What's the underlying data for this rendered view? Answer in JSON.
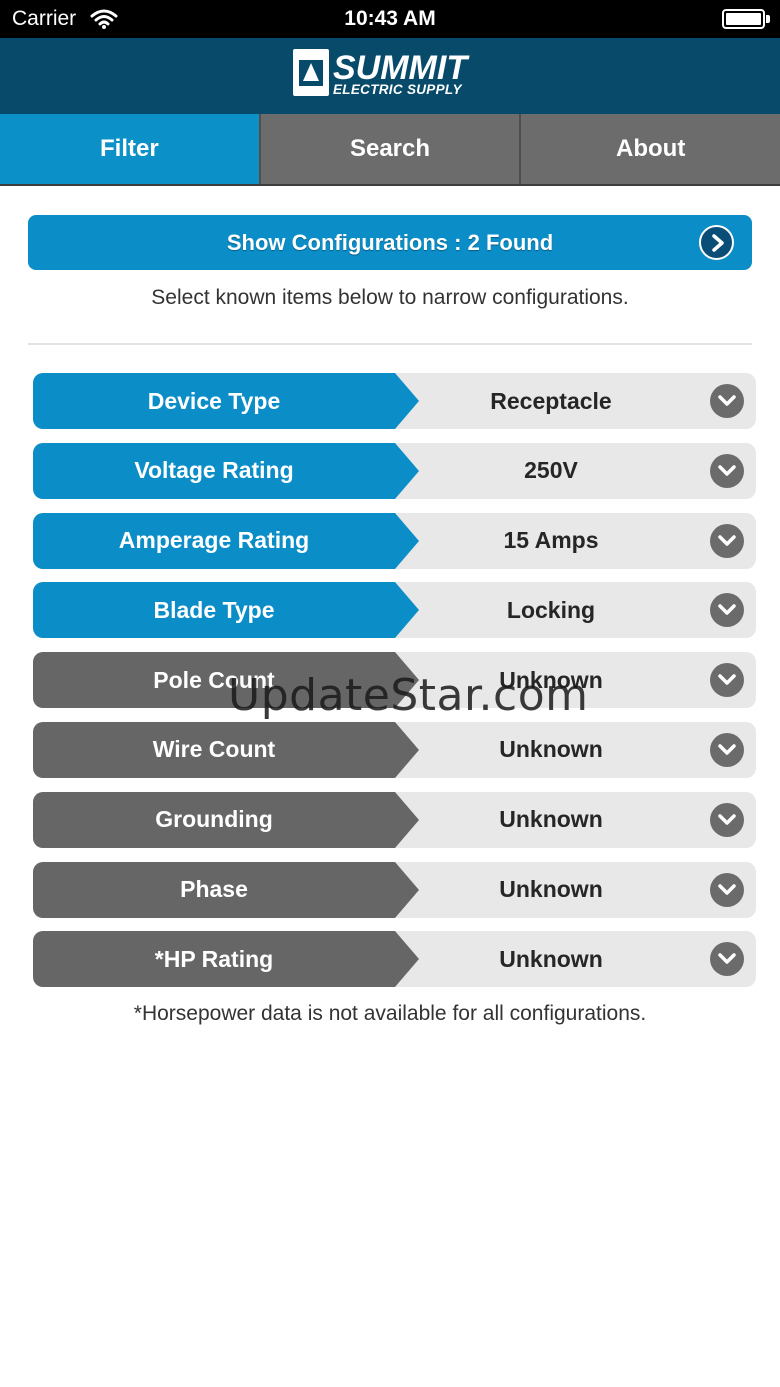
{
  "status_bar": {
    "carrier": "Carrier",
    "time": "10:43 AM"
  },
  "brand": {
    "wordmark": "SUMMIT",
    "subtitle": "ELECTRIC SUPPLY"
  },
  "tabs": [
    {
      "label": "Filter",
      "active": true
    },
    {
      "label": "Search",
      "active": false
    },
    {
      "label": "About",
      "active": false
    }
  ],
  "show_configurations": {
    "label": "Show Configurations : 2 Found"
  },
  "hint": "Select known items below to narrow configurations.",
  "filters": [
    {
      "label": "Device Type",
      "value": "Receptacle",
      "known": true
    },
    {
      "label": "Voltage Rating",
      "value": "250V",
      "known": true
    },
    {
      "label": "Amperage Rating",
      "value": "15 Amps",
      "known": true
    },
    {
      "label": "Blade Type",
      "value": "Locking",
      "known": true
    },
    {
      "label": "Pole Count",
      "value": "Unknown",
      "known": false
    },
    {
      "label": "Wire Count",
      "value": "Unknown",
      "known": false
    },
    {
      "label": "Grounding",
      "value": "Unknown",
      "known": false
    },
    {
      "label": "Phase",
      "value": "Unknown",
      "known": false
    },
    {
      "label": "*HP Rating",
      "value": "Unknown",
      "known": false
    }
  ],
  "footnote": "*Horsepower data is not available for all configurations.",
  "watermark": "UpdateStar.com",
  "colors": {
    "accent": "#0b8ec8",
    "brand": "#074a6a",
    "unknown": "#666666"
  }
}
